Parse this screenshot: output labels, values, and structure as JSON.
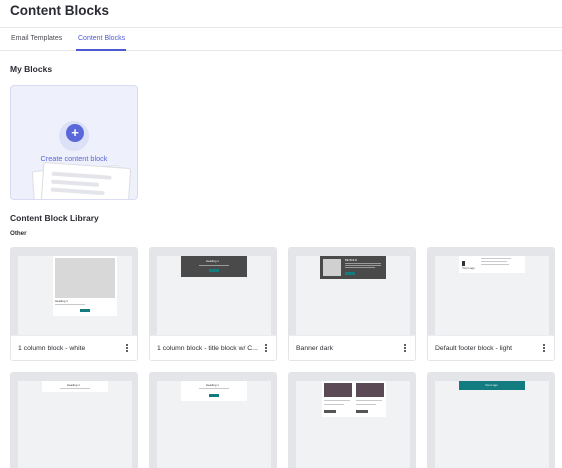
{
  "header": {
    "title": "Content Blocks"
  },
  "tabs": [
    {
      "label": "Email Templates",
      "active": false
    },
    {
      "label": "Content Blocks",
      "active": true
    }
  ],
  "my_blocks": {
    "title": "My Blocks",
    "create_label": "Create content block",
    "create_icon": "plus-icon"
  },
  "library": {
    "title": "Content Block Library",
    "category": "Other",
    "cards": [
      {
        "name": "1 column block - white"
      },
      {
        "name": "1 column block - title block w/ C..."
      },
      {
        "name": "Banner dark"
      },
      {
        "name": "Default footer block - light"
      }
    ],
    "thumbs": {
      "heading": "Heading 1",
      "banner": "BE BOLD",
      "logo": "Your Logo"
    }
  },
  "colors": {
    "accent": "#4c5bd4",
    "teal": "#137c80",
    "dark_banner": "#4a4a4a"
  }
}
